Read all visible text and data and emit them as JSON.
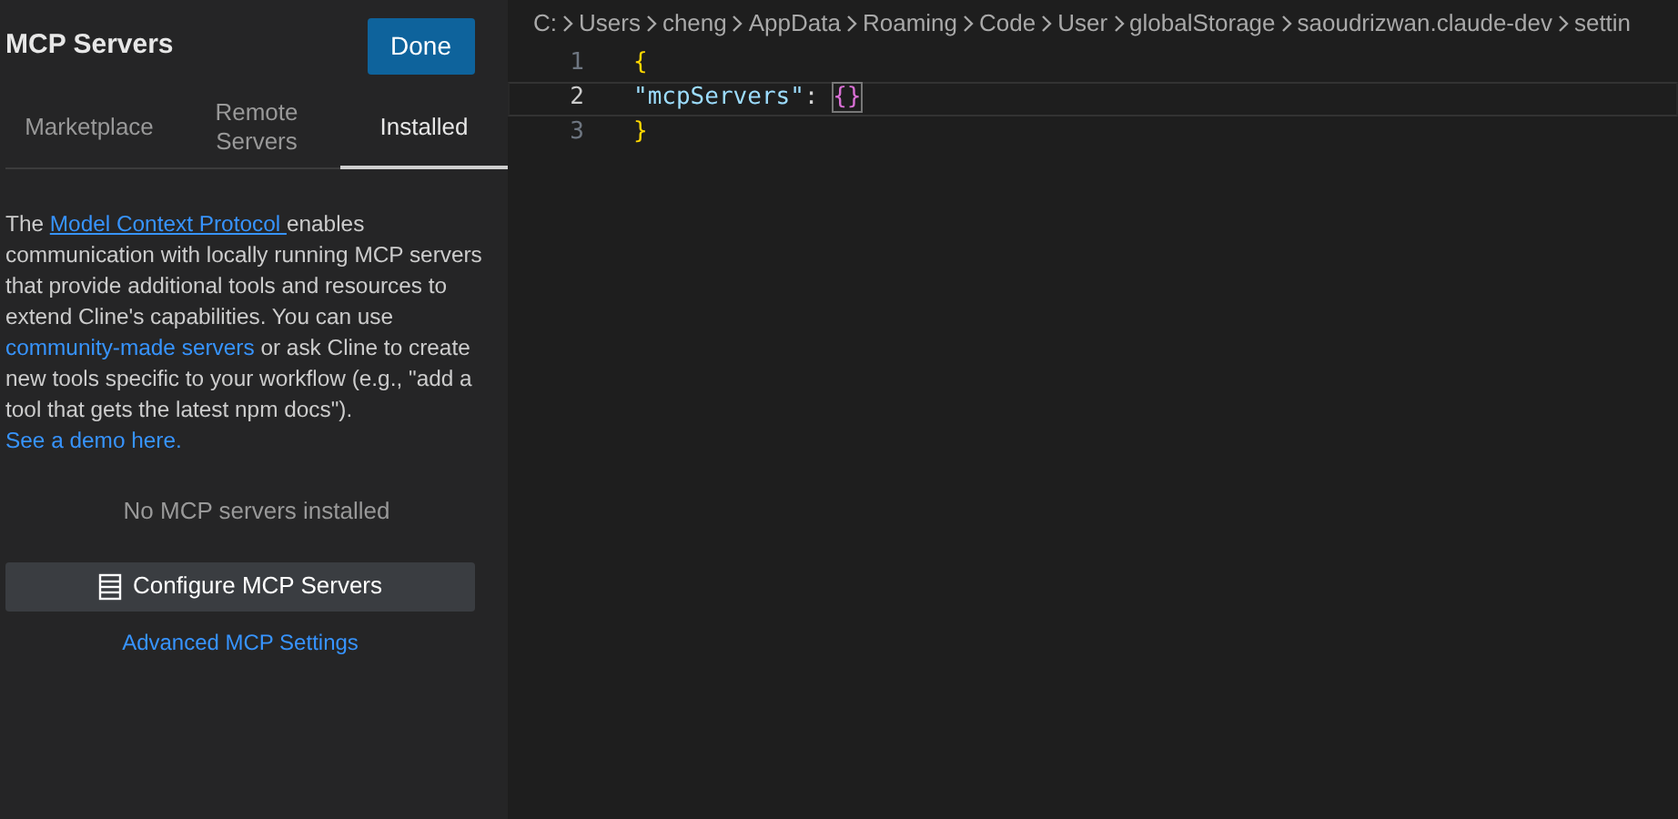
{
  "panel": {
    "title": "MCP Servers",
    "done_button": "Done",
    "tabs": [
      {
        "label": "Marketplace",
        "selected": false
      },
      {
        "label": "Remote Servers",
        "selected": false
      },
      {
        "label": "Installed",
        "selected": true
      }
    ],
    "description": [
      {
        "kind": "text",
        "text": "The "
      },
      {
        "kind": "link",
        "text": "Model Context Protocol ",
        "underline": true
      },
      {
        "kind": "text",
        "text": "enables communication with locally running MCP servers that provide additional tools and resources to extend Cline's capabilities. You can use "
      },
      {
        "kind": "link",
        "text": "community-made servers",
        "underline": false
      },
      {
        "kind": "text",
        "text": " or ask Cline to create new tools specific to your workflow (e.g., \"add a tool that gets the latest npm docs\"). "
      },
      {
        "kind": "link",
        "text": "See a demo here.",
        "underline": false
      }
    ],
    "empty_message": "No MCP servers installed",
    "configure_button": "Configure MCP Servers",
    "advanced_link": "Advanced MCP Settings"
  },
  "editor": {
    "breadcrumbs": [
      "C:",
      "Users",
      "cheng",
      "AppData",
      "Roaming",
      "Code",
      "User",
      "globalStorage",
      "saoudrizwan.claude-dev",
      "settin"
    ],
    "lines": [
      {
        "number": "1",
        "current": false,
        "tokens": [
          {
            "kind": "brace",
            "text": "{"
          }
        ]
      },
      {
        "number": "2",
        "current": true,
        "tokens": [
          {
            "kind": "key",
            "text": "\"mcpServers\""
          },
          {
            "kind": "punct",
            "text": ": "
          },
          {
            "kind": "brace2",
            "text": "{}"
          }
        ]
      },
      {
        "number": "3",
        "current": false,
        "tokens": [
          {
            "kind": "brace",
            "text": "}"
          }
        ]
      }
    ]
  }
}
